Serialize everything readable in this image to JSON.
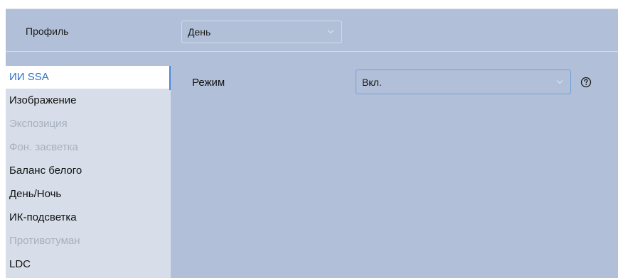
{
  "header": {
    "profile_label": "Профиль",
    "profile_value": "День"
  },
  "sidebar": {
    "items": [
      {
        "label": "ИИ SSA",
        "state": "active"
      },
      {
        "label": "Изображение",
        "state": "normal"
      },
      {
        "label": "Экспозиция",
        "state": "disabled"
      },
      {
        "label": "Фон. засветка",
        "state": "disabled"
      },
      {
        "label": "Баланс белого",
        "state": "normal"
      },
      {
        "label": "День/Ночь",
        "state": "normal"
      },
      {
        "label": "ИК-подсветка",
        "state": "normal"
      },
      {
        "label": "Противотуман",
        "state": "disabled"
      },
      {
        "label": "LDC",
        "state": "normal"
      }
    ]
  },
  "main": {
    "mode_label": "Режим",
    "mode_value": "Вкл.",
    "help_icon": "question-circle-icon"
  },
  "colors": {
    "panel_bg": "#b1c0d8",
    "sidebar_bg": "#d8dee9",
    "active_text": "#2d72c8",
    "disabled_text": "#a7b0be",
    "focus_border": "#6f9fde"
  }
}
